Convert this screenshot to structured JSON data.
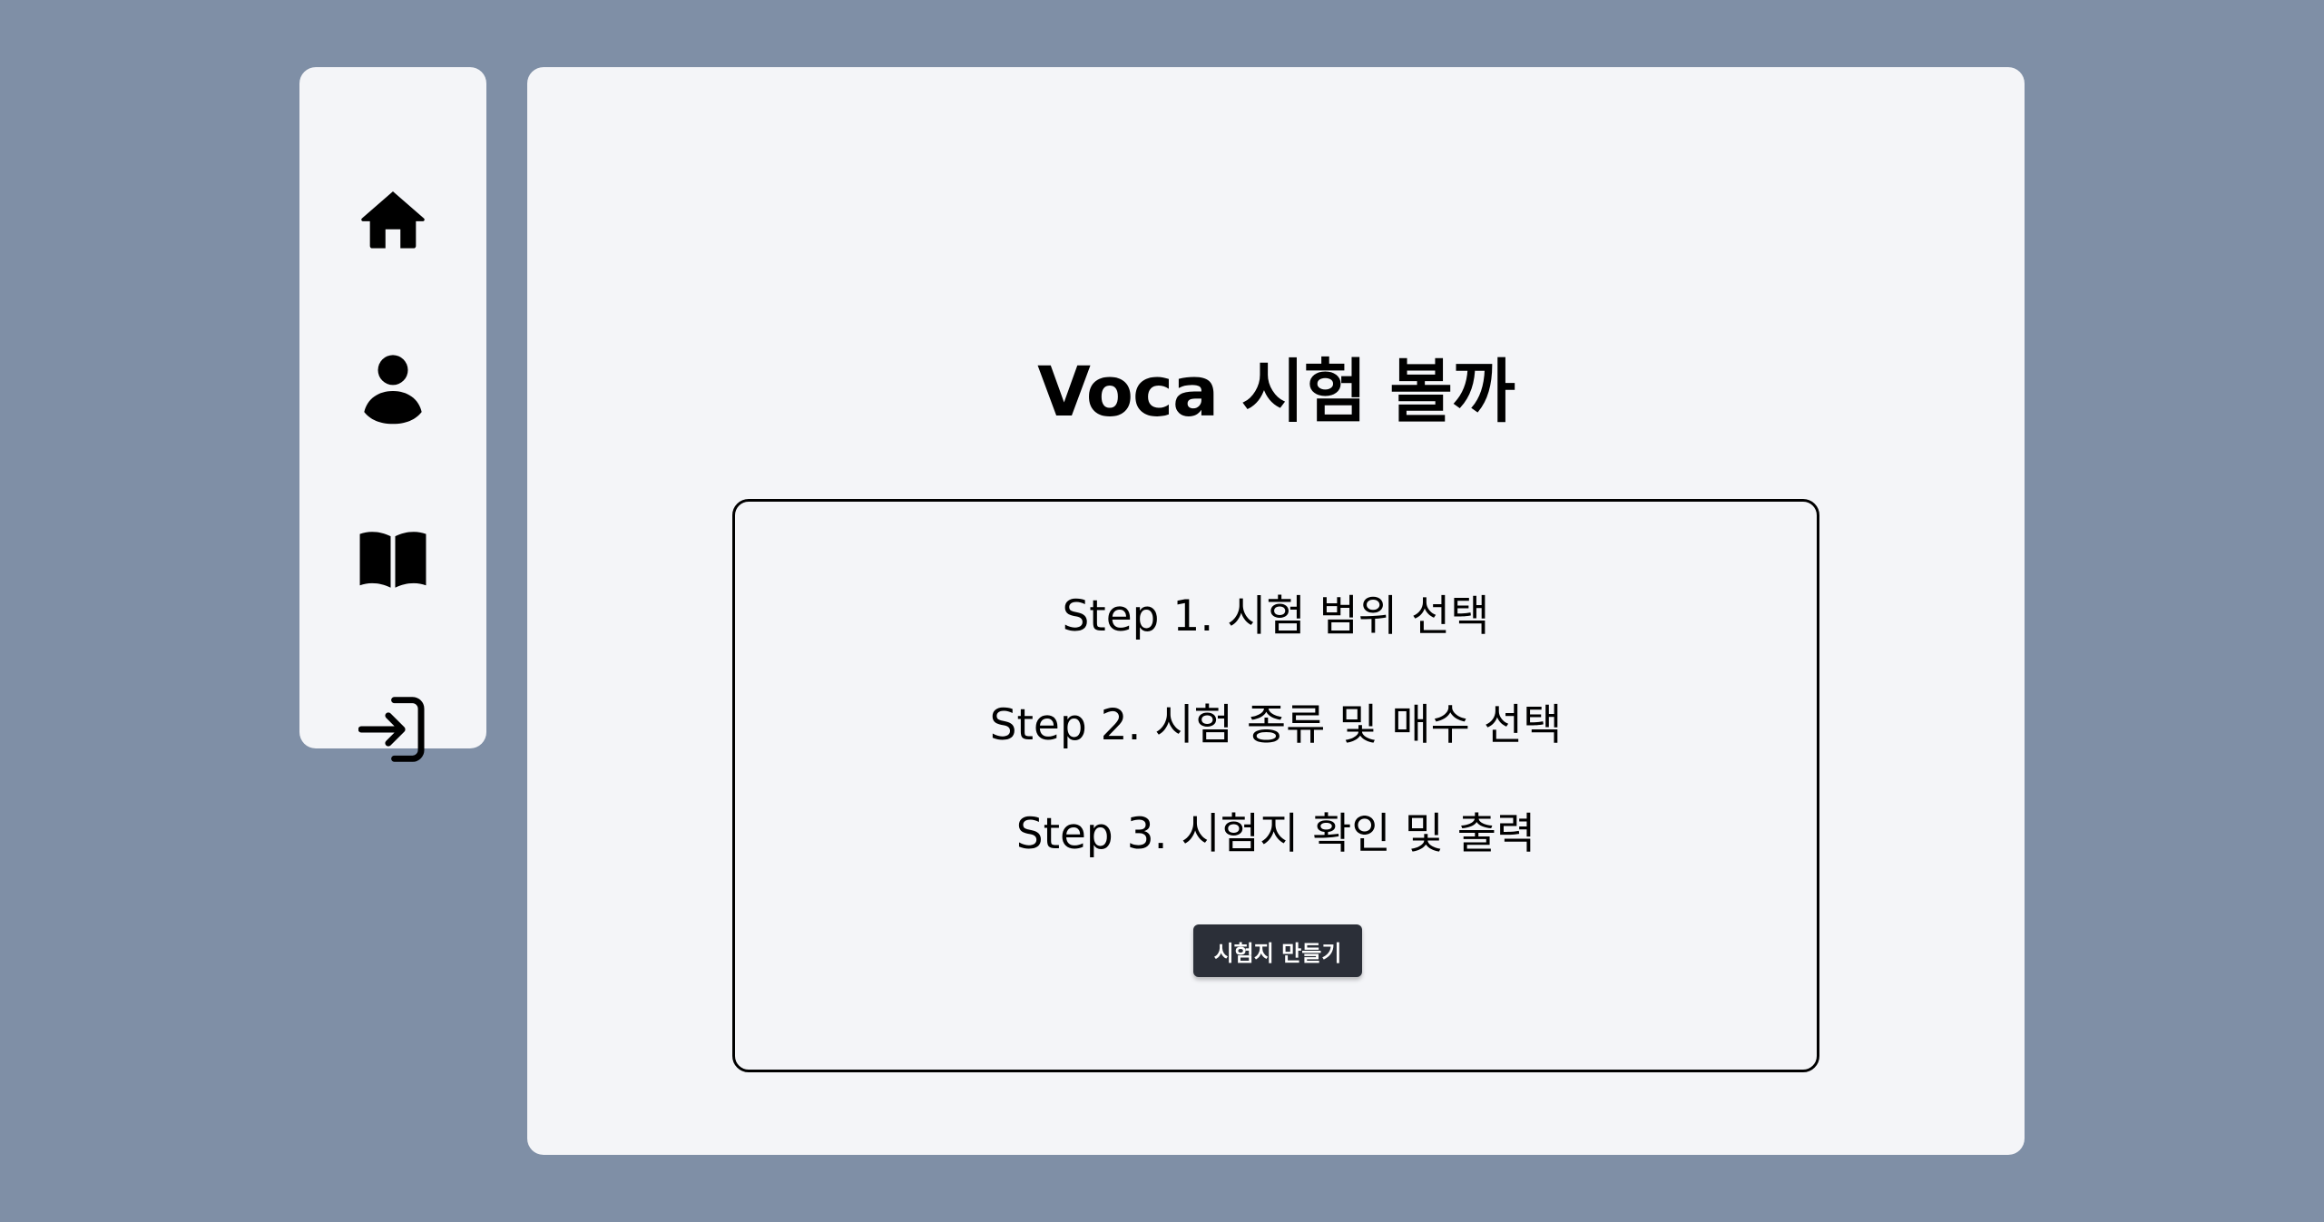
{
  "sidebar": {
    "items": [
      {
        "icon": "home-icon"
      },
      {
        "icon": "user-icon"
      },
      {
        "icon": "book-icon"
      },
      {
        "icon": "login-icon"
      }
    ]
  },
  "main": {
    "title": "Voca 시험 볼까",
    "steps": [
      "Step 1. 시험 범위 선택",
      "Step 2. 시험 종류 및 매수 선택",
      "Step 3. 시험지 확인 및 출력"
    ],
    "button_label": "시험지 만들기"
  },
  "colors": {
    "background": "#7f8fa6",
    "panel": "#f4f5f8",
    "button": "#2b2f38"
  }
}
